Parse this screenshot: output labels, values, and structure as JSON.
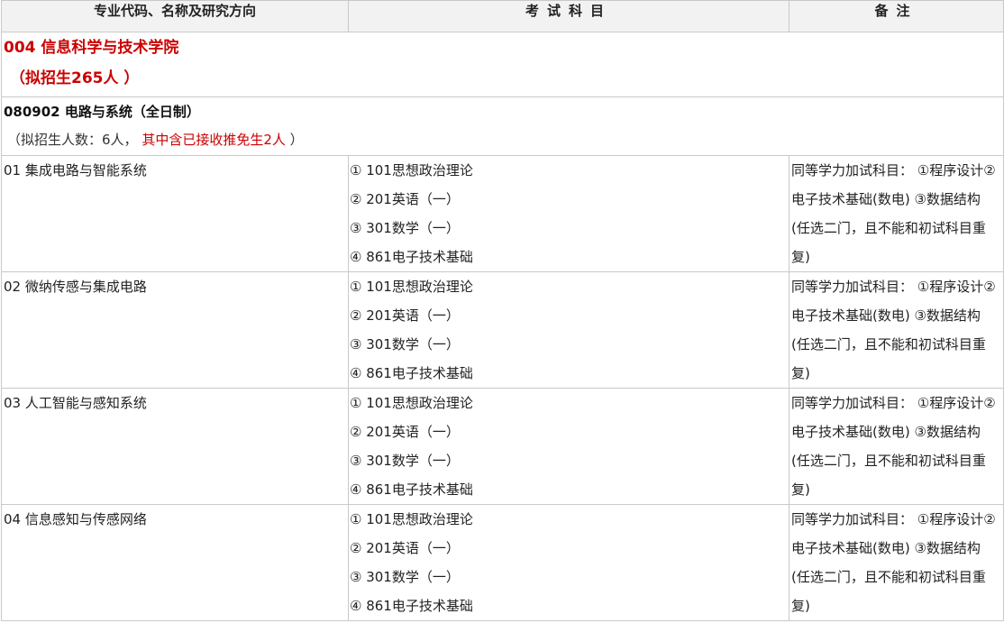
{
  "header": {
    "col1": "专业代码、名称及研究方向",
    "col2": "考试科目",
    "col3": "备注"
  },
  "college": {
    "name": "004 信息科学与技术学院",
    "quota": "（拟招生265人 ）"
  },
  "major": {
    "name": "080902 电路与系统（全日制）",
    "quota_prefix": "（拟招生人数：6人，",
    "quota_red": "其中含已接收推免生2人",
    "quota_suffix": "）"
  },
  "directions": [
    {
      "name": "01 集成电路与智能系统",
      "subjects": [
        "① 101思想政治理论",
        "② 201英语（一）",
        "③ 301数学（一）",
        "④ 861电子技术基础"
      ],
      "note": "同等学力加试科目： ①程序设计②电子技术基础(数电) ③数据结构 (任选二门，且不能和初试科目重复)"
    },
    {
      "name": "02 微纳传感与集成电路",
      "subjects": [
        "① 101思想政治理论",
        "② 201英语（一）",
        "③ 301数学（一）",
        "④ 861电子技术基础"
      ],
      "note": "同等学力加试科目： ①程序设计②电子技术基础(数电) ③数据结构 (任选二门，且不能和初试科目重复)"
    },
    {
      "name": "03 人工智能与感知系统",
      "subjects": [
        "① 101思想政治理论",
        "② 201英语（一）",
        "③ 301数学（一）",
        "④ 861电子技术基础"
      ],
      "note": "同等学力加试科目： ①程序设计②电子技术基础(数电) ③数据结构 (任选二门，且不能和初试科目重复)"
    },
    {
      "name": "04 信息感知与传感网络",
      "subjects": [
        "① 101思想政治理论",
        "② 201英语（一）",
        "③ 301数学（一）",
        "④ 861电子技术基础"
      ],
      "note": "同等学力加试科目： ①程序设计②电子技术基础(数电) ③数据结构 (任选二门，且不能和初试科目重复)"
    }
  ]
}
